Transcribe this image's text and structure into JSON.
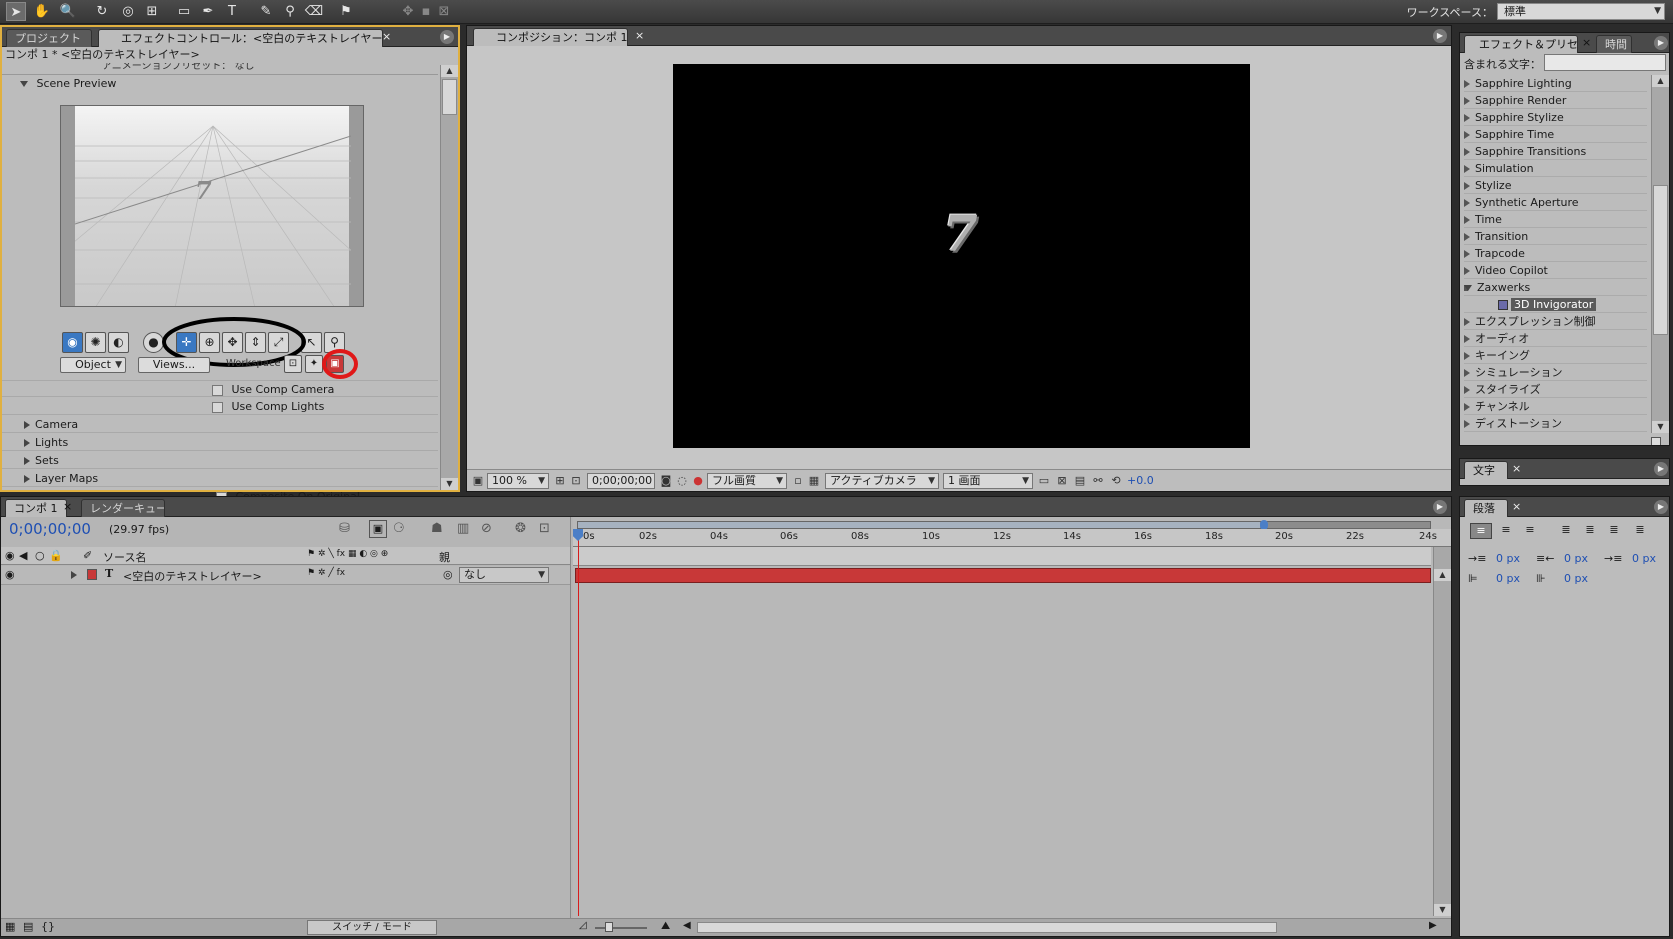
{
  "toolbar": {
    "workspace_label": "ワークスペース：",
    "workspace_value": "標準"
  },
  "effect_controls": {
    "tabs": [
      "プロジェクト",
      "エフェクトコントロール：<空白のテキストレイヤー>"
    ],
    "breadcrumb": "コンポ 1 * <空白のテキストレイヤー>",
    "preset_row": "アニメーションプリセット：",
    "preset_value": "なし",
    "scene_preview": "Scene Preview",
    "preview_glyph": "7",
    "object_select": "Object",
    "views_select": "Views...",
    "overlay_label": "Workspace",
    "use_comp_camera": "Use Comp Camera",
    "use_comp_lights": "Use Comp Lights",
    "groups": [
      "Camera",
      "Lights",
      "Sets",
      "Layer Maps"
    ],
    "composite_on_original": "Composite On Original"
  },
  "composition": {
    "tab": "コンポジション：コンポ 1",
    "glyph": "7",
    "zoom": "100 %",
    "timecode": "0;00;00;00",
    "quality": "フル画質",
    "camera": "アクティブカメラ",
    "views": "1 画面",
    "exposure": "+0.0"
  },
  "effects_presets": {
    "tabs": [
      "エフェクト＆プリセット",
      "時間"
    ],
    "search_label": "含まれる文字：",
    "search_value": "",
    "items": [
      {
        "label": "Sapphire Lighting",
        "type": "folder"
      },
      {
        "label": "Sapphire Render",
        "type": "folder"
      },
      {
        "label": "Sapphire Stylize",
        "type": "folder"
      },
      {
        "label": "Sapphire Time",
        "type": "folder"
      },
      {
        "label": "Sapphire Transitions",
        "type": "folder"
      },
      {
        "label": "Simulation",
        "type": "folder"
      },
      {
        "label": "Stylize",
        "type": "folder"
      },
      {
        "label": "Synthetic Aperture",
        "type": "folder"
      },
      {
        "label": "Time",
        "type": "folder"
      },
      {
        "label": "Transition",
        "type": "folder"
      },
      {
        "label": "Trapcode",
        "type": "folder"
      },
      {
        "label": "Video Copilot",
        "type": "folder"
      },
      {
        "label": "Zaxwerks",
        "type": "open-folder"
      },
      {
        "label": "3D Invigorator",
        "type": "effect-selected"
      },
      {
        "label": "エクスプレッション制御",
        "type": "folder"
      },
      {
        "label": "オーディオ",
        "type": "folder"
      },
      {
        "label": "キーイング",
        "type": "folder"
      },
      {
        "label": "シミュレーション",
        "type": "folder"
      },
      {
        "label": "スタイライズ",
        "type": "folder"
      },
      {
        "label": "チャンネル",
        "type": "folder"
      },
      {
        "label": "ディストーション",
        "type": "folder"
      }
    ]
  },
  "text_panel": {
    "tab": "文字"
  },
  "paragraph_panel": {
    "tab": "段落",
    "indent_left": "0 px",
    "indent_right": "0 px",
    "indent_first": "0 px",
    "space_before": "0 px",
    "space_after": "0 px"
  },
  "timeline": {
    "tabs": [
      "コンポ 1",
      "レンダーキュー"
    ],
    "timecode": "0;00;00;00",
    "fps": "(29.97 fps)",
    "col_source": "ソース名",
    "col_parent": "親",
    "layer_name": "<空白のテキストレイヤー>",
    "layer_type_glyph": "T",
    "layer_parent": "なし",
    "ruler": [
      "0s",
      "02s",
      "04s",
      "06s",
      "08s",
      "10s",
      "12s",
      "14s",
      "16s",
      "18s",
      "20s",
      "22s",
      "24s"
    ],
    "switch_mode": "スイッチ / モード"
  },
  "colors": {
    "layer_bar": "#c83838",
    "selection_blue": "#3a78c2",
    "panel_bg": "#bcbcbc",
    "focus_border": "#e0b040",
    "timecode_blue": "#1e4fb3"
  }
}
